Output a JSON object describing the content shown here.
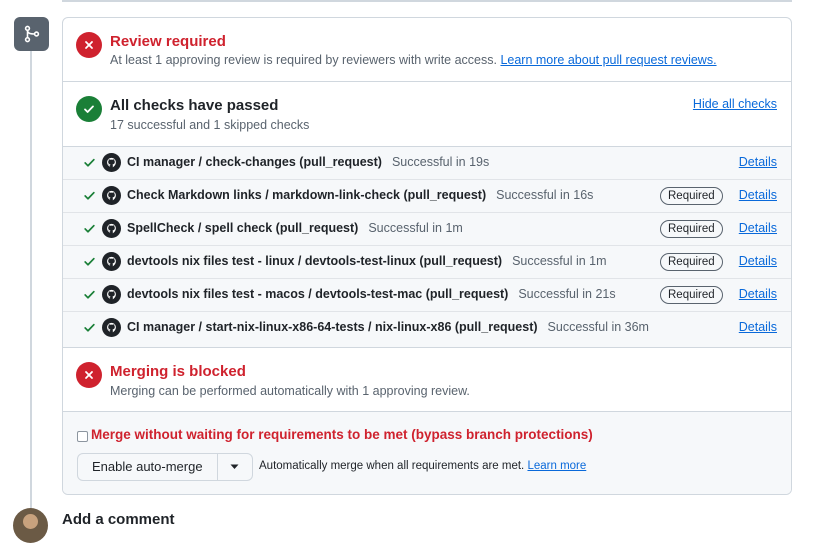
{
  "review": {
    "title": "Review required",
    "subtitle": "At least 1 approving review is required by reviewers with write access.",
    "link": "Learn more about pull request reviews."
  },
  "checks": {
    "title": "All checks have passed",
    "subtitle": "17 successful and 1 skipped checks",
    "hide_label": "Hide all checks",
    "details_label": "Details",
    "required_label": "Required",
    "items": [
      {
        "name": "CI manager / check-changes (pull_request)",
        "status": "Successful in 19s",
        "required": false
      },
      {
        "name": "Check Markdown links / markdown-link-check (pull_request)",
        "status": "Successful in 16s",
        "required": true
      },
      {
        "name": "SpellCheck / spell check (pull_request)",
        "status": "Successful in 1m",
        "required": true
      },
      {
        "name": "devtools nix files test - linux / devtools-test-linux (pull_request)",
        "status": "Successful in 1m",
        "required": true
      },
      {
        "name": "devtools nix files test - macos / devtools-test-mac (pull_request)",
        "status": "Successful in 21s",
        "required": true
      },
      {
        "name": "CI manager / start-nix-linux-x86-64-tests / nix-linux-x86 (pull_request)",
        "status": "Successful in 36m",
        "required": false
      }
    ]
  },
  "blocked": {
    "title": "Merging is blocked",
    "subtitle": "Merging can be performed automatically with 1 approving review."
  },
  "bypass": {
    "label": "Merge without waiting for requirements to be met (bypass branch protections)"
  },
  "auto_merge": {
    "button_label": "Enable auto-merge",
    "description": "Automatically merge when all requirements are met.",
    "link": "Learn more"
  },
  "comment": {
    "heading": "Add a comment"
  },
  "colors": {
    "danger": "#cf222e",
    "success": "#1a7f37",
    "accent": "#0969da",
    "muted": "#59636e"
  },
  "icons": {
    "merge_badge": "git-merge-icon",
    "review_status": "x-circle-icon",
    "checks_status": "check-circle-icon",
    "row_check": "check-icon",
    "row_app": "github-icon",
    "blocked_status": "x-circle-icon",
    "caret": "triangle-down-icon"
  }
}
